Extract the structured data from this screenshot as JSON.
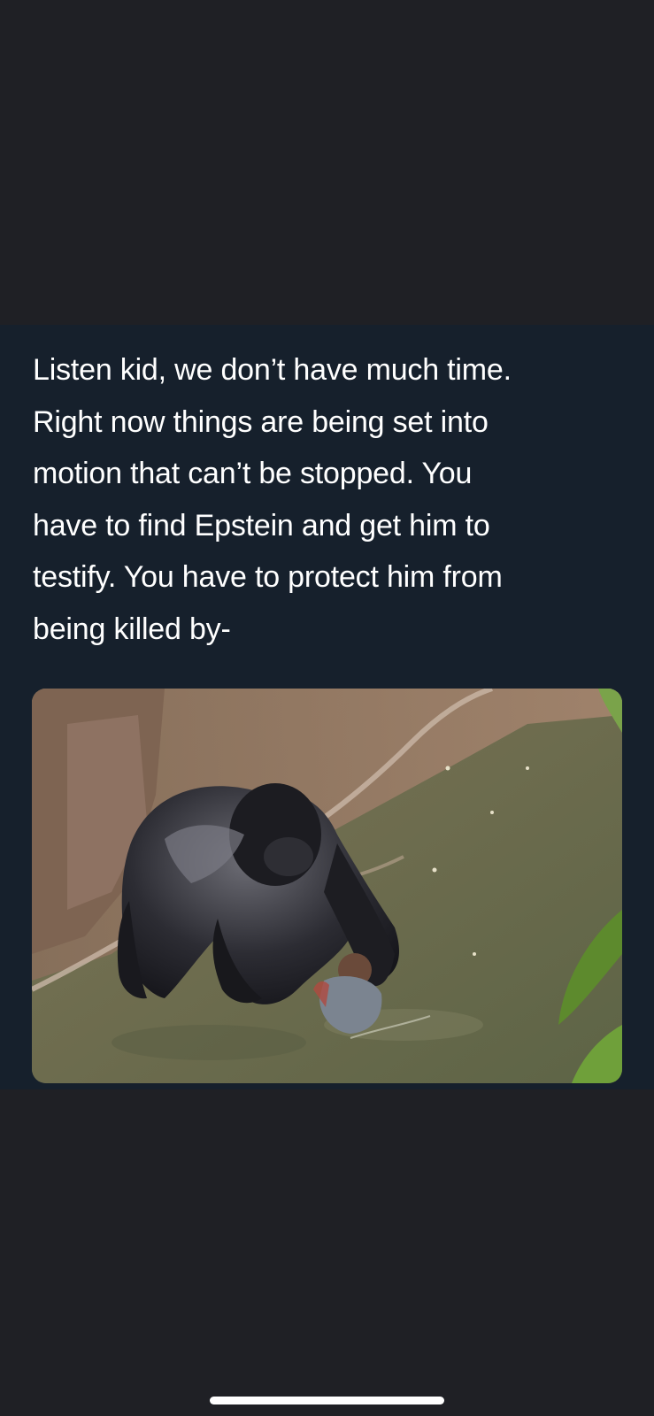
{
  "tweet": {
    "lines": [
      "Listen kid, we don’t have much time.",
      "Right now things are being set into",
      "motion that can’t be stopped. You",
      "have to find Epstein and get him to",
      "testify. You have to protect him from",
      "being killed by-"
    ]
  },
  "media": {
    "subject": "gorilla-with-child-in-water-photo"
  },
  "colors": {
    "page_background": "#1f2025",
    "card_background": "#16202c",
    "text": "#ffffff"
  }
}
